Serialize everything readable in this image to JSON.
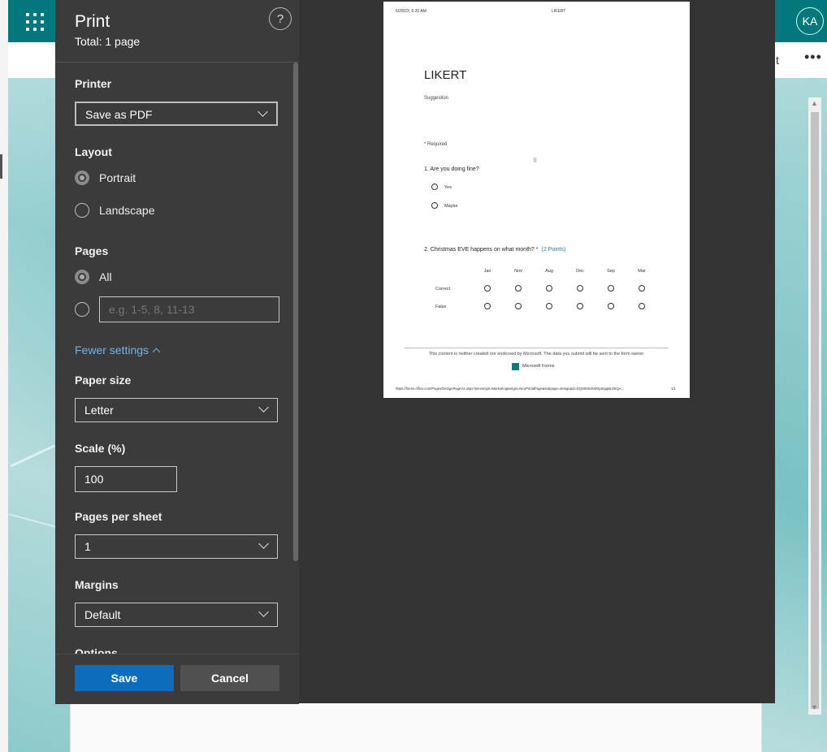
{
  "app": {
    "avatar_initials": "KA",
    "subbar_text": "t",
    "more_label": "•••"
  },
  "dialog": {
    "title": "Print",
    "total": "Total: 1 page",
    "help_label": "?",
    "printer": {
      "label": "Printer",
      "value": "Save as PDF"
    },
    "layout": {
      "label": "Layout",
      "options": [
        "Portrait",
        "Landscape"
      ],
      "selected": "Portrait"
    },
    "pages": {
      "label": "Pages",
      "options": [
        "All"
      ],
      "selected": "All",
      "custom_placeholder": "e.g. 1-5, 8, 11-13"
    },
    "fewer_settings": "Fewer settings",
    "paper_size": {
      "label": "Paper size",
      "value": "Letter"
    },
    "scale": {
      "label": "Scale (%)",
      "value": "100"
    },
    "pages_per_sheet": {
      "label": "Pages per sheet",
      "value": "1"
    },
    "margins": {
      "label": "Margins",
      "value": "Default"
    },
    "options_label": "Options",
    "save_label": "Save",
    "cancel_label": "Cancel"
  },
  "preview": {
    "header_date": "6/28/23, 6:20 AM",
    "header_title": "LIKERT",
    "form_title": "LIKERT",
    "form_subtitle": "Suggestion",
    "required_star": "*",
    "required_text": "Required",
    "drag_handle": "⠿",
    "q1": {
      "text": "1. Are you doing fine?",
      "options": [
        "Yes",
        "Maybe"
      ]
    },
    "q2": {
      "text": "2. Christmas EVE happens on what month?",
      "star": "*",
      "points": "(2 Points)",
      "columns": [
        "Jan",
        "Nov",
        "Aug",
        "Dec",
        "Sep",
        "Mar"
      ],
      "rows": [
        "Correct",
        "False"
      ]
    },
    "disclaimer": "This content is neither created nor endorsed by Microsoft. The data you submit will be sent to the form owner.",
    "brand": "Microsoft Forms",
    "footer_url": "https://forms.office.com/Pages/DesignPageV2.aspx?prevorigin=Marketing&origin=NeoPortalPage&subpage=design&id=DQSIkWdsW0yxEjajBLZtrQA...",
    "page_count": "1/1"
  }
}
